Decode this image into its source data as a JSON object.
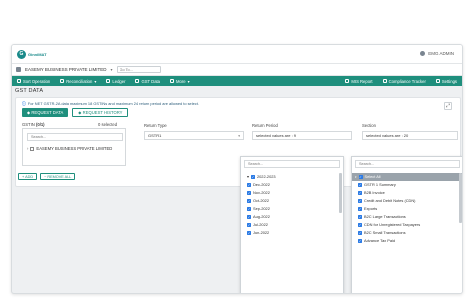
{
  "app": {
    "logo_text": "GinniMAT",
    "user": "EMG ADMIN"
  },
  "context": {
    "company": "EASEMY BUSINESS PRIVATE LIMITED",
    "search_placeholder": "Go To..."
  },
  "nav": {
    "left": [
      "Sort Operation",
      "Reconciliation",
      "Ledger",
      "GST Data",
      "More"
    ],
    "right": [
      "MIS Report",
      "Compliance Tracker",
      "Settings"
    ]
  },
  "page": {
    "title": "GST DATA",
    "notice": "For NET GSTR-2A data maximum 18 GSTINs and maximum 24 return period are allowed to select.",
    "request_data": "REQUEST DATA",
    "request_history": "REQUEST HISTORY"
  },
  "gstin": {
    "label": "GSTIN",
    "count": "(0/1)",
    "selected": "0 selected",
    "search_placeholder": "Search...",
    "item": "EASEMY BUSINESS PRIVATE LIMITED",
    "add": "+ ADD",
    "remove_all": "− REMOVE ALL"
  },
  "return_type": {
    "label": "Return Type",
    "value": "GSTR1"
  },
  "return_period": {
    "label": "Return Period",
    "value": "selected values are : 9",
    "search_placeholder": "Search...",
    "items": [
      "2022-2023",
      "Dec-2022",
      "Nov-2022",
      "Oct-2022",
      "Sep-2022",
      "Aug-2022",
      "Jul-2022",
      "Jun-2022"
    ]
  },
  "section": {
    "label": "Section",
    "value": "selected values are : 20",
    "search_placeholder": "Search...",
    "items": [
      "Select All",
      "GSTR 1 Summary",
      "B2B Invoice",
      "Credit and Debit Notes (CDN)",
      "Exports",
      "B2C Large Transactions",
      "CDN for Unregistered Taxpayers",
      "B2C Small Transactions",
      "Advance Tax Paid"
    ]
  }
}
